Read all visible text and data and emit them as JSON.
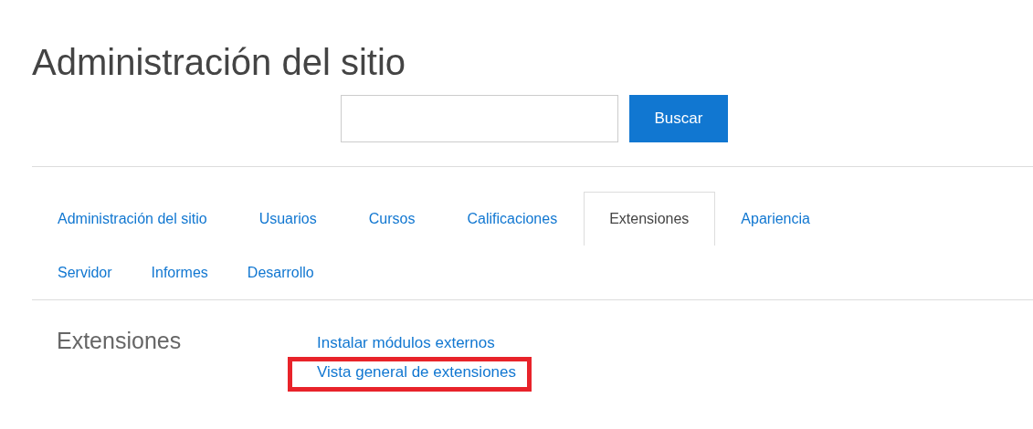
{
  "page_title": "Administración del sitio",
  "search": {
    "button": "Buscar"
  },
  "tab_rows": [
    [
      {
        "label": "Administración del sitio",
        "selected": false
      },
      {
        "label": "Usuarios",
        "selected": false
      },
      {
        "label": "Cursos",
        "selected": false
      },
      {
        "label": "Calificaciones",
        "selected": false
      },
      {
        "label": "Extensiones",
        "selected": true
      },
      {
        "label": "Apariencia",
        "selected": false
      }
    ],
    [
      {
        "label": "Servidor",
        "selected": false
      },
      {
        "label": "Informes",
        "selected": false
      },
      {
        "label": "Desarrollo",
        "selected": false
      }
    ]
  ],
  "section": {
    "heading": "Extensiones",
    "links": [
      {
        "label": "Instalar módulos externos",
        "highlighted": false
      },
      {
        "label": "Vista general de extensiones",
        "highlighted": true
      }
    ]
  }
}
